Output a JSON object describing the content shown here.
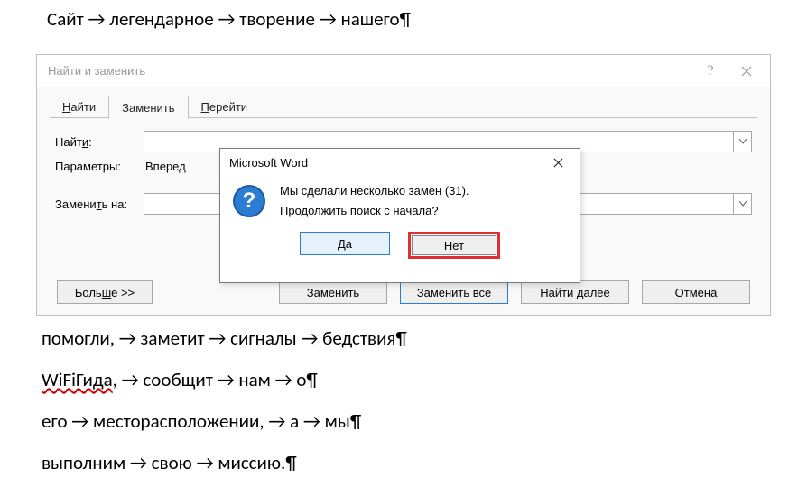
{
  "document": {
    "line1": "Сайт → легендарное → творение   →   нашего¶",
    "line2": "помогли,   →   заметит   →   сигналы   →   бедствия¶",
    "line3_pre": "WiFiГида",
    "line3_post": ",   →   сообщит   →   нам → о¶",
    "line4": "его  →  месторасположении, → а   →   мы¶",
    "line5": "выполним   →   свою → миссию.¶"
  },
  "find_replace": {
    "title": "Найти и заменить",
    "help": "?",
    "tabs": {
      "find": "Найти",
      "replace": "Заменить",
      "goto": "Перейти"
    },
    "labels": {
      "find": "Найти:",
      "params": "Параметры:",
      "replace": "Заменить на:"
    },
    "params_value": "Вперед",
    "find_value": "",
    "replace_value": "",
    "buttons": {
      "more": "Больше >>",
      "replace": "Заменить",
      "replace_all": "Заменить все",
      "find_next": "Найти далее",
      "cancel": "Отмена"
    }
  },
  "msgbox": {
    "title": "Microsoft Word",
    "line1": "Мы сделали несколько замен (31).",
    "line2": "Продолжить поиск с начала?",
    "yes": "Да",
    "no": "Нет"
  }
}
